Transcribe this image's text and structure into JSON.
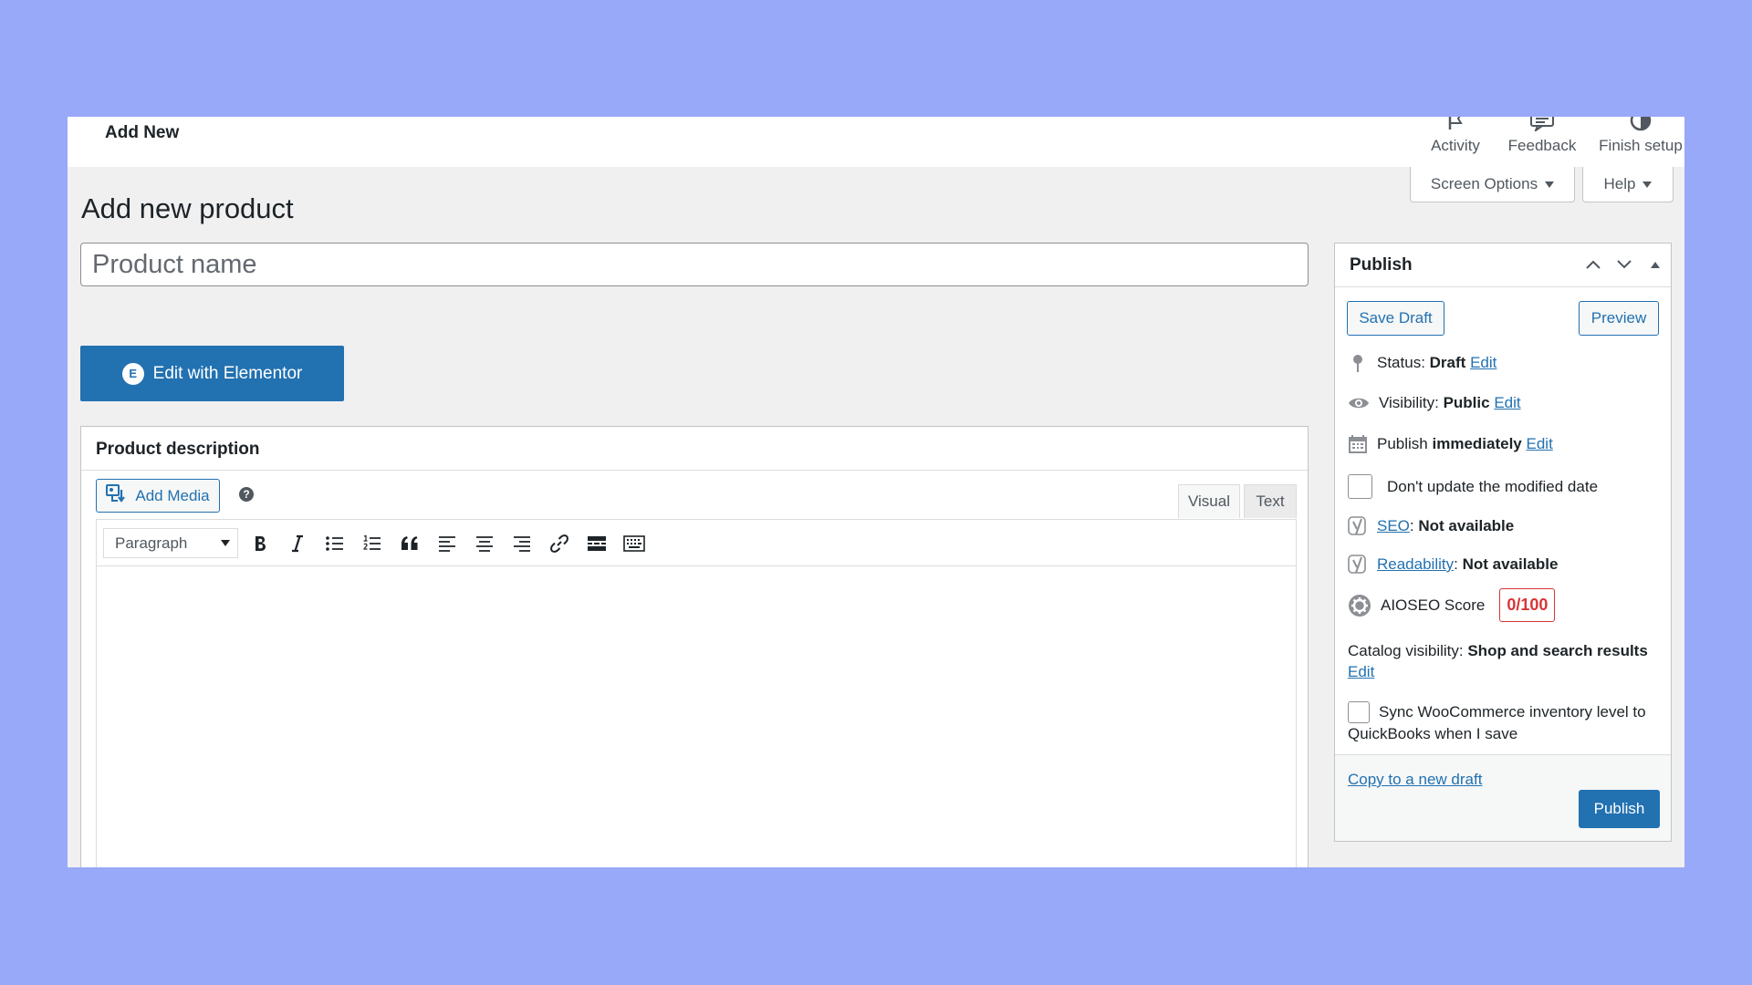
{
  "topbar": {
    "title": "Add New",
    "actions": [
      {
        "label": "Activity",
        "icon": "flag-icon"
      },
      {
        "label": "Feedback",
        "icon": "feedback-icon"
      },
      {
        "label": "Finish setup",
        "icon": "progress-icon"
      }
    ]
  },
  "screen_options": {
    "label": "Screen Options"
  },
  "help": {
    "label": "Help"
  },
  "page": {
    "title": "Add new product"
  },
  "product_name": {
    "placeholder": "Product name",
    "value": ""
  },
  "elementor": {
    "label": "Edit with Elementor",
    "icon_glyph": "E"
  },
  "description": {
    "title": "Product description",
    "add_media_label": "Add Media",
    "help_glyph": "?",
    "tabs": {
      "visual": "Visual",
      "text": "Text"
    },
    "format_select": "Paragraph"
  },
  "publish": {
    "title": "Publish",
    "save_draft": "Save Draft",
    "preview": "Preview",
    "status": {
      "label": "Status:",
      "value": "Draft",
      "edit": "Edit"
    },
    "visibility": {
      "label": "Visibility:",
      "value": "Public",
      "edit": "Edit"
    },
    "schedule": {
      "label": "Publish",
      "value": "immediately",
      "edit": "Edit"
    },
    "dont_update": "Don't update the modified date",
    "seo": {
      "link": "SEO",
      "value": "Not available"
    },
    "readability": {
      "link": "Readability",
      "value": "Not available"
    },
    "aioseo": {
      "label": "AIOSEO Score",
      "score": "0/100"
    },
    "catalog": {
      "label": "Catalog visibility:",
      "value": "Shop and search results",
      "edit": "Edit"
    },
    "sync": {
      "line1": "Sync WooCommerce inventory level to",
      "line2": "QuickBooks when I save"
    },
    "copy_draft": "Copy to a new draft",
    "publish_button": "Publish"
  },
  "colors": {
    "background": "#97a9f8",
    "primary": "#2271b1",
    "score_red": "#d63638"
  }
}
